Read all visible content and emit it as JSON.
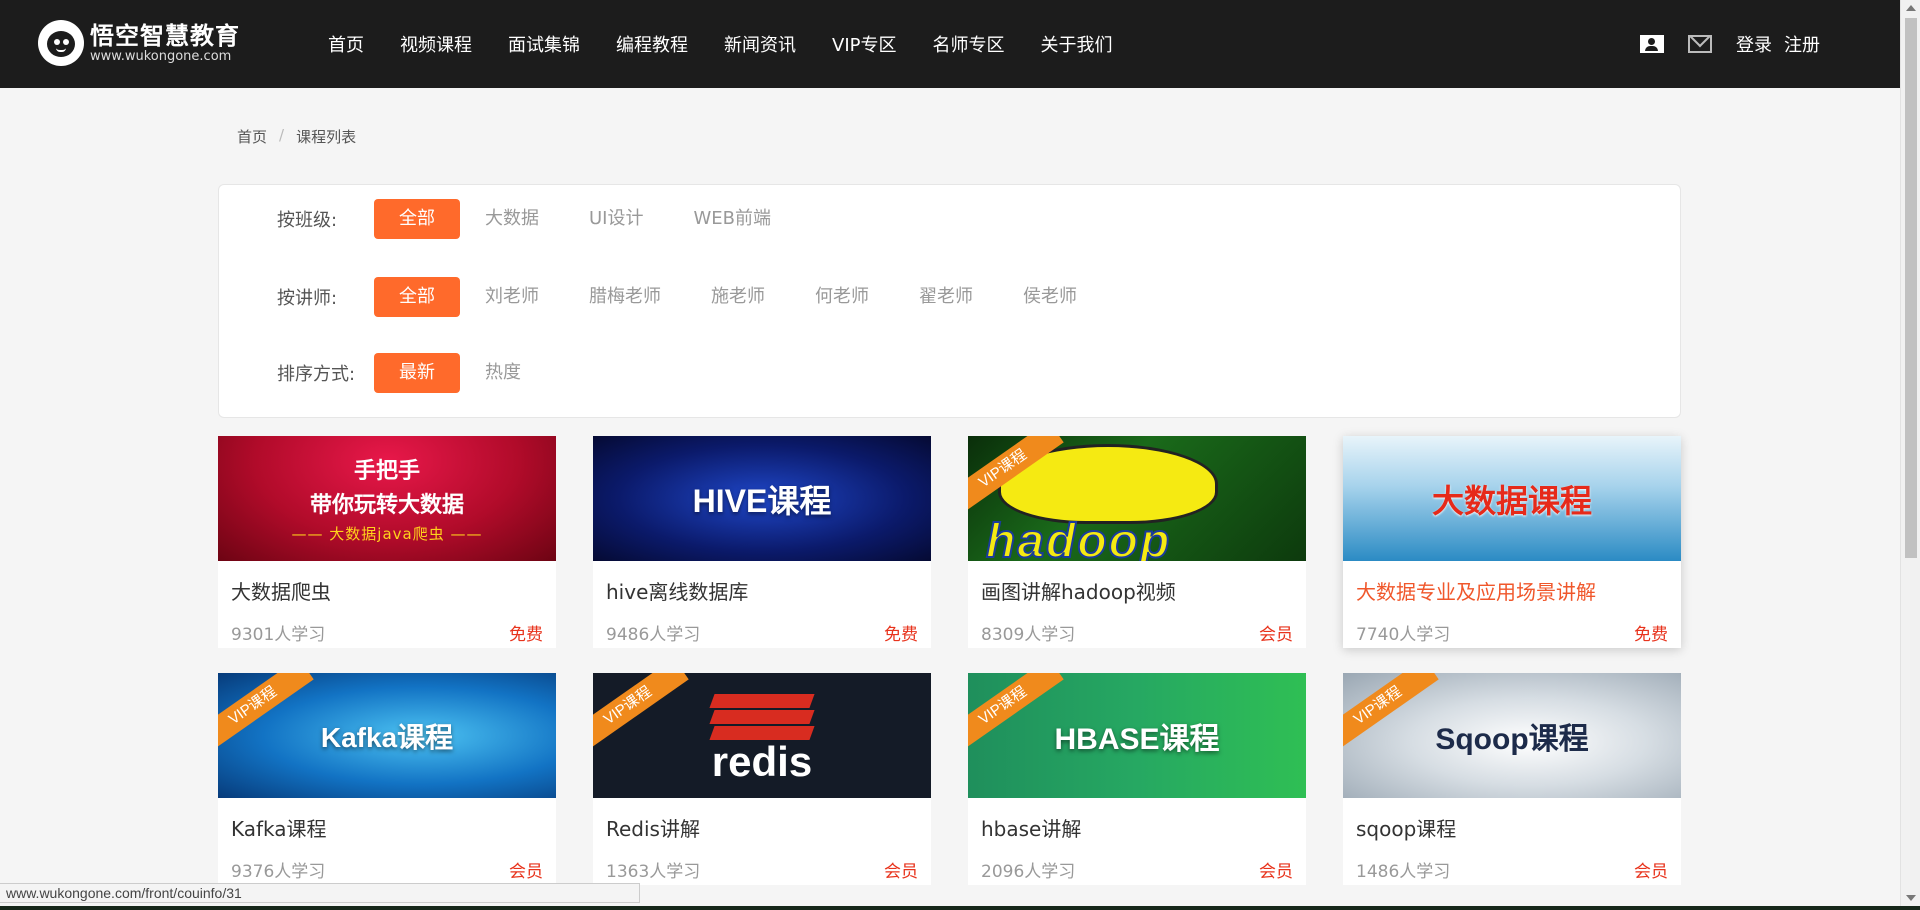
{
  "header": {
    "logo_name": "悟空智慧教育",
    "logo_url": "www.wukongone.com",
    "nav": [
      "首页",
      "视频课程",
      "面试集锦",
      "编程教程",
      "新闻资讯",
      "VIP专区",
      "名师专区",
      "关于我们"
    ],
    "login": "登录",
    "register": "注册"
  },
  "breadcrumb": {
    "home": "首页",
    "separator": "/",
    "current": "课程列表"
  },
  "filters": {
    "class": {
      "label": "按班级:",
      "options": [
        "全部",
        "大数据",
        "UI设计",
        "WEB前端"
      ],
      "selected": "全部"
    },
    "teacher": {
      "label": "按讲师:",
      "options": [
        "全部",
        "刘老师",
        "腊梅老师",
        "施老师",
        "何老师",
        "翟老师",
        "侯老师"
      ],
      "selected": "全部"
    },
    "sort": {
      "label": "排序方式:",
      "options": [
        "最新",
        "热度"
      ],
      "selected": "最新"
    }
  },
  "courses": [
    {
      "name": "大数据爬虫",
      "learners": "9301人学习",
      "price": "免费",
      "thumb_lines": [
        "手把手",
        "带你玩转大数据",
        "—— 大数据java爬虫 ——"
      ]
    },
    {
      "name": "hive离线数据库",
      "learners": "9486人学习",
      "price": "免费",
      "thumb_title": "HIVE课程"
    },
    {
      "name": "画图讲解hadoop视频",
      "learners": "8309人学习",
      "price": "会员",
      "ribbon": "VIP课程",
      "thumb_title": "hadoop"
    },
    {
      "name": "大数据专业及应用场景讲解",
      "learners": "7740人学习",
      "price": "免费",
      "thumb_title": "大数据课程"
    },
    {
      "name": "Kafka课程",
      "learners": "9376人学习",
      "price": "会员",
      "ribbon": "VIP课程",
      "thumb_title": "Kafka课程"
    },
    {
      "name": "Redis讲解",
      "learners": "1363人学习",
      "price": "会员",
      "ribbon": "VIP课程",
      "thumb_title": "redis"
    },
    {
      "name": "hbase讲解",
      "learners": "2096人学习",
      "price": "会员",
      "ribbon": "VIP课程",
      "thumb_title": "HBASE课程"
    },
    {
      "name": "sqoop课程",
      "learners": "1486人学习",
      "price": "会员",
      "ribbon": "VIP课程",
      "thumb_title": "Sqoop课程"
    }
  ],
  "status_url": "www.wukongone.com/front/couinfo/31",
  "colors": {
    "accent": "#ff6a2b",
    "price": "#e8331c",
    "header_bg": "#1c1c1c"
  }
}
